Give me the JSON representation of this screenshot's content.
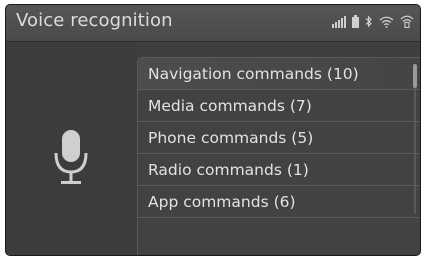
{
  "header": {
    "title": "Voice recognition",
    "status_icons": [
      "signal-bars-icon",
      "battery-icon",
      "bluetooth-icon",
      "wifi-icon",
      "wifi-hotspot-icon"
    ]
  },
  "left_panel": {
    "icon": "microphone-icon"
  },
  "commands": [
    {
      "label": "Navigation commands (10)",
      "selected": true
    },
    {
      "label": "Media commands (7)"
    },
    {
      "label": "Phone commands (5)"
    },
    {
      "label": "Radio commands (1)"
    },
    {
      "label": "App commands (6)"
    }
  ]
}
